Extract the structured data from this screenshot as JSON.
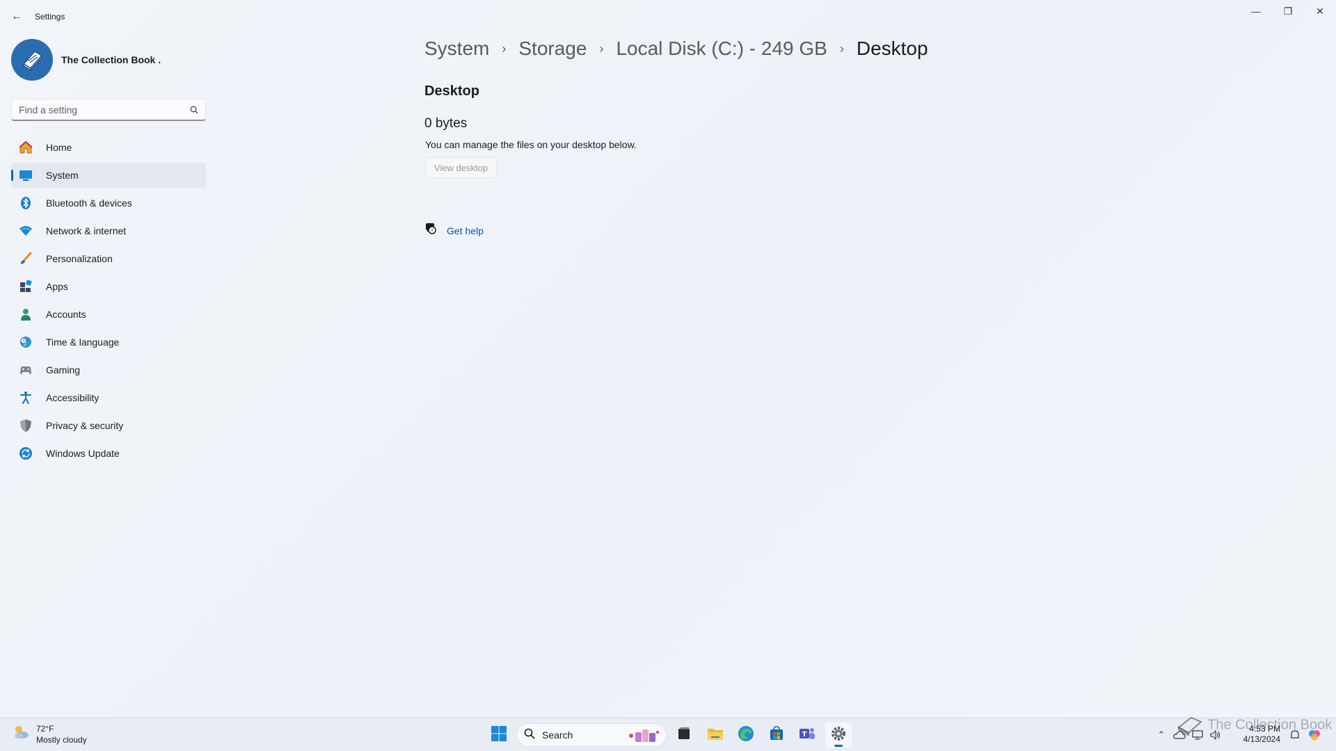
{
  "window": {
    "app_title": "Settings",
    "back_label": "←",
    "minimize_label": "—",
    "maximize_label": "❐",
    "close_label": "✕"
  },
  "profile": {
    "name": "The Collection Book ."
  },
  "search": {
    "placeholder": "Find a setting"
  },
  "sidebar": {
    "items": [
      {
        "label": "Home",
        "icon": "home-icon"
      },
      {
        "label": "System",
        "icon": "system-icon",
        "active": true
      },
      {
        "label": "Bluetooth & devices",
        "icon": "bluetooth-icon"
      },
      {
        "label": "Network & internet",
        "icon": "wifi-icon"
      },
      {
        "label": "Personalization",
        "icon": "brush-icon"
      },
      {
        "label": "Apps",
        "icon": "apps-icon"
      },
      {
        "label": "Accounts",
        "icon": "person-icon"
      },
      {
        "label": "Time & language",
        "icon": "globe-clock-icon"
      },
      {
        "label": "Gaming",
        "icon": "gamepad-icon"
      },
      {
        "label": "Accessibility",
        "icon": "accessibility-icon"
      },
      {
        "label": "Privacy & security",
        "icon": "shield-icon"
      },
      {
        "label": "Windows Update",
        "icon": "refresh-icon"
      }
    ]
  },
  "breadcrumb": {
    "items": [
      "System",
      "Storage",
      "Local Disk (C:) - 249 GB",
      "Desktop"
    ],
    "separator": "›"
  },
  "main": {
    "section_title": "Desktop",
    "size": "0 bytes",
    "description": "You can manage the files on your desktop below.",
    "view_button": "View desktop",
    "help_label": "Get help"
  },
  "taskbar": {
    "weather_temp": "72°F",
    "weather_desc": "Mostly cloudy",
    "search_label": "Search",
    "time": "4:53 PM",
    "date": "4/13/2024",
    "tray_expand": "⌃"
  },
  "watermark": "The Collection Book",
  "colors": {
    "accent": "#0067c0",
    "link": "#0058b0",
    "nav_active_bg": "#e4e8ee"
  }
}
